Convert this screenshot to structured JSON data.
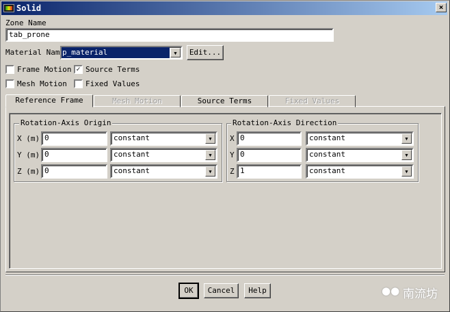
{
  "window": {
    "title": "Solid",
    "close": "×",
    "icon": "fluent-app-icon"
  },
  "zone_name": {
    "label": "Zone Name",
    "value": "tab_prone"
  },
  "material": {
    "label": "Material Name",
    "value": "p_material",
    "edit_label": "Edit..."
  },
  "checkboxes": [
    {
      "label": "Frame Motion",
      "checked": false
    },
    {
      "label": "Source Terms",
      "checked": true
    },
    {
      "label": "Mesh Motion",
      "checked": false
    },
    {
      "label": "Fixed Values",
      "checked": false
    }
  ],
  "tabs": [
    {
      "label": "Reference Frame",
      "active": true,
      "enabled": true
    },
    {
      "label": "Mesh Motion",
      "active": false,
      "enabled": false
    },
    {
      "label": "Source Terms",
      "active": false,
      "enabled": true
    },
    {
      "label": "Fixed Values",
      "active": false,
      "enabled": false
    }
  ],
  "origin": {
    "title": "Rotation-Axis Origin",
    "rows": [
      {
        "label": "X (m)",
        "value": "0",
        "method": "constant"
      },
      {
        "label": "Y (m)",
        "value": "0",
        "method": "constant"
      },
      {
        "label": "Z (m)",
        "value": "0",
        "method": "constant"
      }
    ]
  },
  "direction": {
    "title": "Rotation-Axis Direction",
    "rows": [
      {
        "label": "X",
        "value": "0",
        "method": "constant"
      },
      {
        "label": "Y",
        "value": "0",
        "method": "constant"
      },
      {
        "label": "Z",
        "value": "1",
        "method": "constant"
      }
    ]
  },
  "buttons": {
    "ok": "OK",
    "cancel": "Cancel",
    "help": "Help"
  },
  "watermark": "南流坊"
}
